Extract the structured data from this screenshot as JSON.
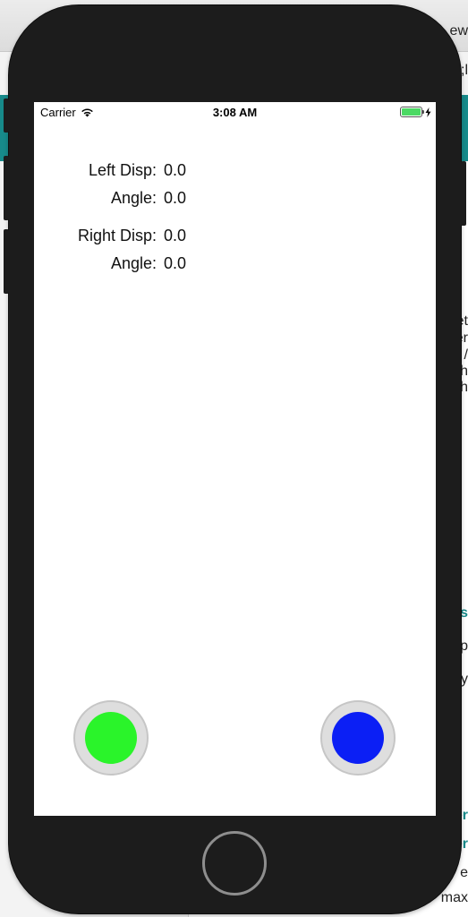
{
  "status_bar": {
    "carrier": "Carrier",
    "time": "3:08 AM",
    "battery_color": "#4cd964"
  },
  "left_joystick": {
    "disp_label": "Left Disp:",
    "disp_value": "0.0",
    "angle_label": "Angle:",
    "angle_value": "0.0",
    "knob_color": "#2af42a"
  },
  "right_joystick": {
    "disp_label": "Right Disp:",
    "disp_value": "0.0",
    "angle_label": "Angle:",
    "angle_value": "0.0",
    "knob_color": "#0b1ff5"
  },
  "background_window": {
    "fragments": [
      "ew",
      ";l",
      "et",
      "er",
      "/",
      "th",
      "ch",
      "s",
      "p",
      "y",
      "er",
      "er",
      "e",
      "max"
    ]
  }
}
